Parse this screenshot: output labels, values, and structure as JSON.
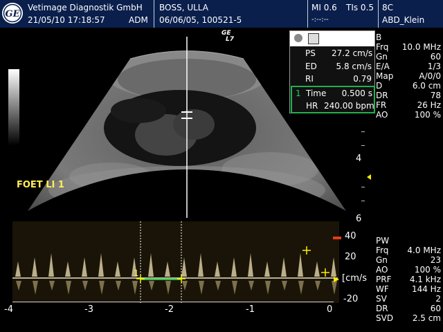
{
  "header": {
    "company": "Vetimage Diagnostik GmbH",
    "datetime": "21/05/10 17:18:57",
    "operator": "ADM",
    "patient_name": "BOSS, ULLA",
    "patient_info": "06/06/05, 100521-5",
    "mi": "MI 0.6",
    "tis": "TIs 0.5",
    "clock": "-:--:--",
    "probe_mode": "8C",
    "preset": "ABD_Klein"
  },
  "image": {
    "ge_mark": "GE",
    "probe_mark": "L7",
    "label": "FOET LI 1",
    "depth_ticks": [
      "4",
      "6"
    ]
  },
  "measurements": {
    "rows": [
      {
        "label": "PS",
        "value": "27.2 cm/s"
      },
      {
        "label": "ED",
        "value": "5.8 cm/s"
      },
      {
        "label": "RI",
        "value": "0.79"
      }
    ],
    "hr_index": "1",
    "time_label": "Time",
    "time_value": "0.500 s",
    "hr_label": "HR",
    "hr_value": "240.00 bpm"
  },
  "bmode_params": {
    "title": "B",
    "rows": [
      {
        "label": "Frq",
        "value": "10.0 MHz"
      },
      {
        "label": "Gn",
        "value": "60"
      },
      {
        "label": "E/A",
        "value": "1/3"
      },
      {
        "label": "Map",
        "value": "A/0/0"
      },
      {
        "label": "D",
        "value": "6.0 cm"
      },
      {
        "label": "DR",
        "value": "78"
      },
      {
        "label": "FR",
        "value": "26 Hz"
      },
      {
        "label": "AO",
        "value": "100 %"
      }
    ]
  },
  "pw_params": {
    "title": "PW",
    "rows": [
      {
        "label": "Frq",
        "value": "4.0 MHz"
      },
      {
        "label": "Gn",
        "value": "23"
      },
      {
        "label": "AO",
        "value": "100 %"
      },
      {
        "label": "PRF",
        "value": "4.1 kHz"
      },
      {
        "label": "WF",
        "value": "144 Hz"
      },
      {
        "label": "SV",
        "value": "2"
      },
      {
        "label": "DR",
        "value": "60"
      },
      {
        "label": "SVD",
        "value": "2.5 cm"
      }
    ]
  },
  "doppler": {
    "velocity_labels": [
      "40",
      "20",
      "[cm/s",
      "-20"
    ],
    "time_labels": [
      "-4",
      "-3",
      "-2",
      "-1",
      "0"
    ],
    "cursor_index": "1",
    "accent_marker": "#e83a1a",
    "cursor_color": "#ffee00"
  }
}
